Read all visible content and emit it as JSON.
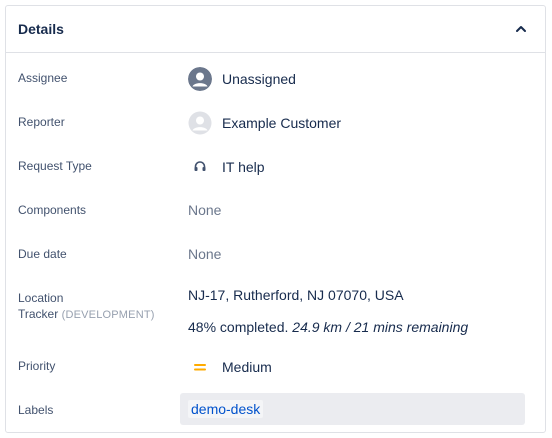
{
  "panel": {
    "title": "Details"
  },
  "fields": {
    "assignee": {
      "label": "Assignee",
      "value": "Unassigned"
    },
    "reporter": {
      "label": "Reporter",
      "value": "Example Customer"
    },
    "request_type": {
      "label": "Request Type",
      "value": "IT help"
    },
    "components": {
      "label": "Components",
      "value": "None"
    },
    "due_date": {
      "label": "Due date",
      "value": "None"
    },
    "location_tracker": {
      "label_line1": "Location",
      "label_line2": "Tracker",
      "dev_tag": "(DEVELOPMENT)",
      "address": "NJ-17, Rutherford, NJ 07070, USA",
      "progress_text": "48% completed.",
      "remaining_text": "24.9 km / 21 mins remaining"
    },
    "priority": {
      "label": "Priority",
      "value": "Medium",
      "color": "#ffab00"
    },
    "labels": {
      "label": "Labels",
      "items": [
        "demo-desk"
      ]
    }
  },
  "icons": {
    "collapse": "chevron-up-icon",
    "assignee": "user-avatar-icon",
    "reporter": "user-avatar-icon",
    "request_type": "headset-icon",
    "priority": "priority-medium-icon"
  }
}
